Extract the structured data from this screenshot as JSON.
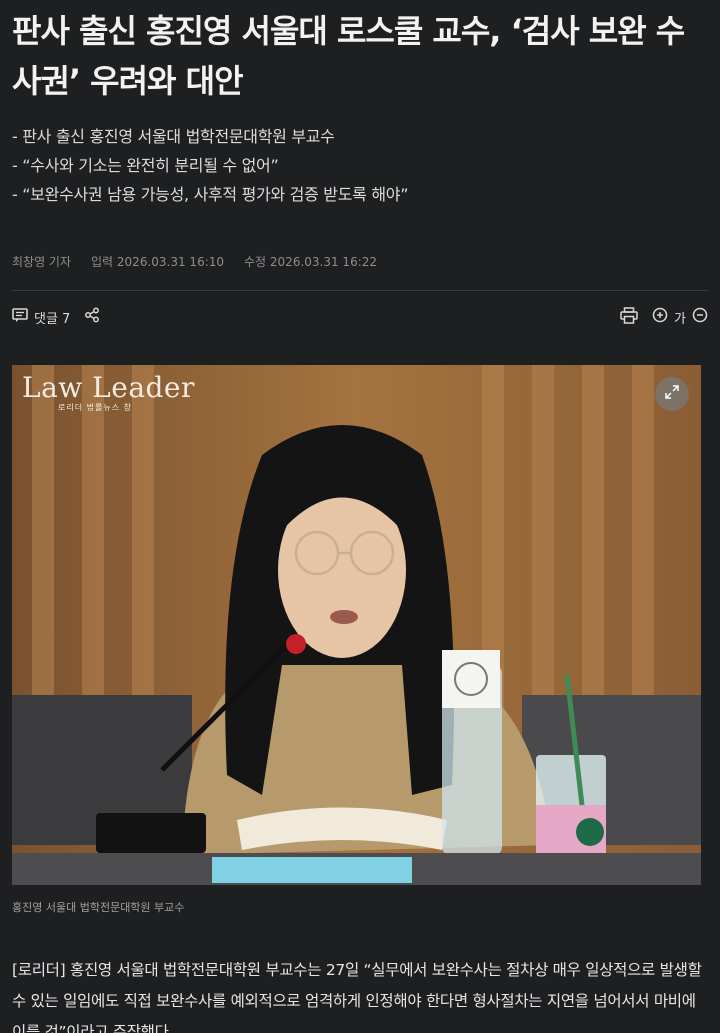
{
  "article": {
    "headline": "판사 출신 홍진영 서울대 로스쿨 교수, ‘검사 보완 수사권’ 우려와 대안",
    "summary": [
      "- 판사 출신 홍진영 서울대 법학전문대학원 부교수",
      "- “수사와 기소는 완전히 분리될 수 없어”",
      "- “보완수사권 남용 가능성, 사후적 평가와 검증 받도록 해야”"
    ],
    "byline": "최창영 기자",
    "published": "입력 2026.03.31 16:10",
    "updated": "수정 2026.03.31 16:22"
  },
  "toolbar": {
    "comments_label": "댓글 7",
    "font_label": "가",
    "icons": [
      "comment-icon",
      "share-icon",
      "print-icon",
      "zoom-in-icon",
      "zoom-out-icon"
    ]
  },
  "photo": {
    "logo_main": "Law Leader",
    "logo_sub": "로리더   법률뉴스 창",
    "caption": "홍진영 서울대 법학전문대학원 부교수",
    "expand_icon": "expand-icon"
  },
  "body": {
    "paragraph": "[로리더] 홍진영 서울대 법학전문대학원 부교수는 27일 “실무에서 보완수사는 절차상 매우 일상적으로 발생할 수 있는 일임에도 직접 보완수사를 예외적으로 엄격하게 인정해야 한다면 형사절차는 지연을 넘어서서 마비에 이를 것”이라고 주장했다."
  },
  "colors": {
    "background": "#1e1f21",
    "text": "#f2f2f2",
    "muted": "#8e8e8e"
  }
}
